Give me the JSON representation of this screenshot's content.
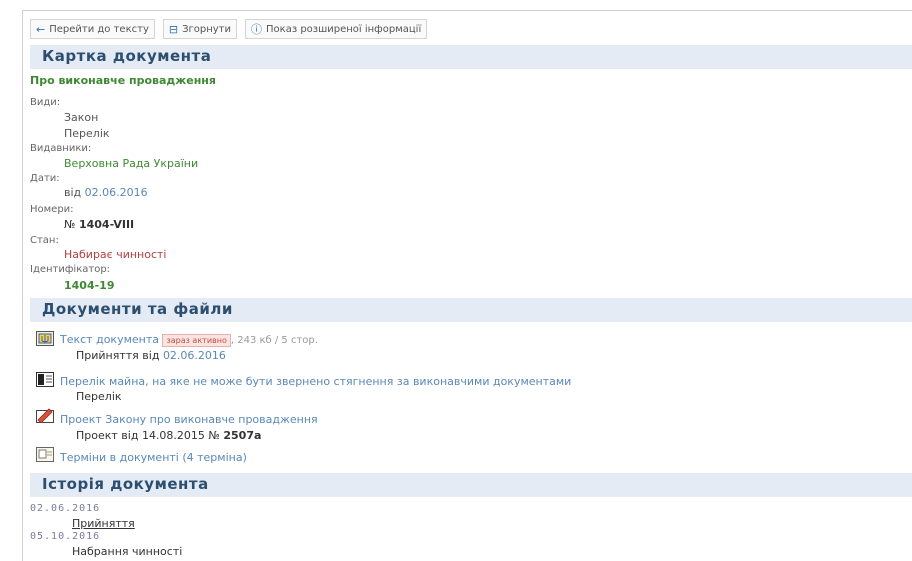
{
  "toolbar": {
    "back_label": "Перейти до тексту",
    "collapse_label": "Згорнути",
    "info_label": "Показ розширеної інформації"
  },
  "card": {
    "heading": "Картка документа",
    "title": "Про виконавче провадження",
    "types_label": "Види:",
    "types": [
      "Закон",
      "Перелік"
    ],
    "publishers_label": "Видавники:",
    "publisher": "Верховна Рада України",
    "dates_label": "Дати:",
    "date_prefix": "від",
    "date": "02.06.2016",
    "numbers_label": "Номери:",
    "number_prefix": "№",
    "number": "1404-VIII",
    "status_label": "Стан:",
    "status": "Набирає чинності",
    "id_label": "Ідентифікатор:",
    "id": "1404-19"
  },
  "files": {
    "heading": "Документи та файли",
    "items": [
      {
        "link": "Текст документа",
        "badge": "зараз активно",
        "meta": ", 243 кб / 5 стор.",
        "sub_prefix": "Прийняття від",
        "sub_date": "02.06.2016"
      },
      {
        "link": "Перелік майна, на яке не може бути звернено стягнення за виконавчими документами",
        "sub": "Перелік"
      },
      {
        "link": "Проект Закону про виконавче провадження",
        "sub_prefix": "Проект від 14.08.2015 №",
        "sub_number": "2507а"
      },
      {
        "link": "Терміни в документі (4 терміна)"
      }
    ]
  },
  "history": {
    "heading": "Історія документа",
    "events": [
      {
        "date": "02.06.2016",
        "event": "Прийняття"
      },
      {
        "date": "05.10.2016",
        "event": "Набрання чинності"
      }
    ]
  },
  "colors": {
    "section_bg": "#e4ebf5",
    "section_text": "#2c4f6f",
    "green": "#3d8a32",
    "link_blue": "#5a88b5",
    "status_red": "#b33f3f"
  }
}
